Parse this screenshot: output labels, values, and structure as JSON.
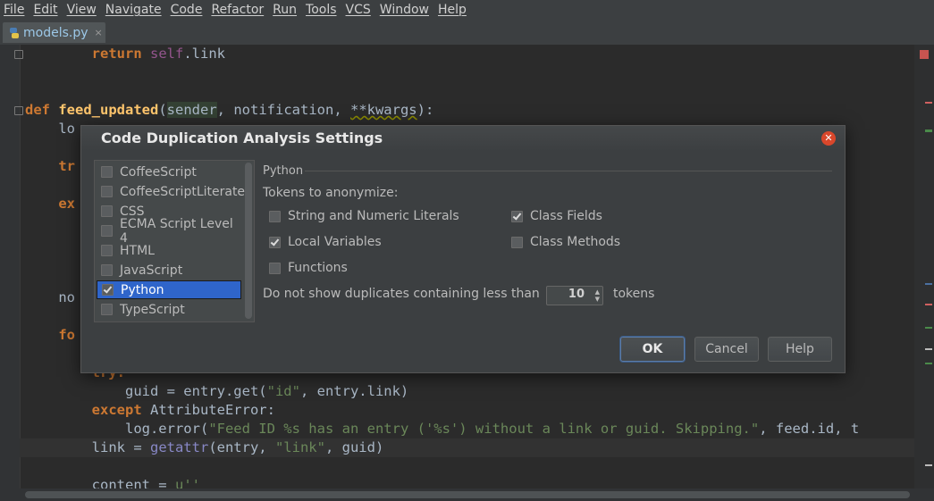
{
  "menu": [
    "File",
    "Edit",
    "View",
    "Navigate",
    "Code",
    "Refactor",
    "Run",
    "Tools",
    "VCS",
    "Window",
    "Help"
  ],
  "tab": {
    "filename": "models.py",
    "close": "×"
  },
  "code": {
    "l1_kw": "return",
    "l1_self": "self",
    "l1_rest": ".link",
    "l4_def": "def",
    "l4_fn": "feed_updated",
    "l4_open": "(",
    "l4_param": "sender",
    "l4_rest": ", notification, ",
    "l4_kwargs": "**kwargs",
    "l4_close": "):",
    "l5": "lo",
    "l7": "tr",
    "l8": "ex",
    "l13": "no",
    "l15": "fo",
    "l17_try": "try:",
    "l18": "guid = entry.get(",
    "l18_str": "\"id\"",
    "l18_rest": ", entry.link)",
    "l19_kw": "except",
    "l19_cls": " AttributeError:",
    "l20_a": "log.error(",
    "l20_str": "\"Feed ID %s has an entry ('%s') without a link or guid. Skipping.\"",
    "l20_rest": ", feed.id, t",
    "l21_a": "link = ",
    "l21_b": "getattr",
    "l21_c": "(entry, ",
    "l21_str": "\"link\"",
    "l21_d": ", guid)",
    "l23_a": "content = ",
    "l23_str": "u''"
  },
  "dialog": {
    "title": "Code Duplication Analysis Settings",
    "languages": [
      {
        "label": "CoffeeScript",
        "checked": false
      },
      {
        "label": "CoffeeScriptLiterate",
        "checked": false
      },
      {
        "label": "CSS",
        "checked": false
      },
      {
        "label": "ECMA Script Level 4",
        "checked": false
      },
      {
        "label": "HTML",
        "checked": false
      },
      {
        "label": "JavaScript",
        "checked": false
      },
      {
        "label": "Python",
        "checked": true
      },
      {
        "label": "TypeScript",
        "checked": false
      }
    ],
    "section": "Python",
    "tokens_label": "Tokens to anonymize:",
    "options": {
      "string_numeric": {
        "label": "String and Numeric Literals",
        "checked": false
      },
      "local_vars": {
        "label": "Local Variables",
        "checked": true
      },
      "functions": {
        "label": "Functions",
        "checked": false
      },
      "class_fields": {
        "label": "Class Fields",
        "checked": true
      },
      "class_methods": {
        "label": "Class Methods",
        "checked": false
      }
    },
    "min_dup_label": "Do not show duplicates containing less than",
    "min_tokens": "10",
    "tokens_suffix": "tokens",
    "buttons": {
      "ok": "OK",
      "cancel": "Cancel",
      "help": "Help"
    }
  }
}
